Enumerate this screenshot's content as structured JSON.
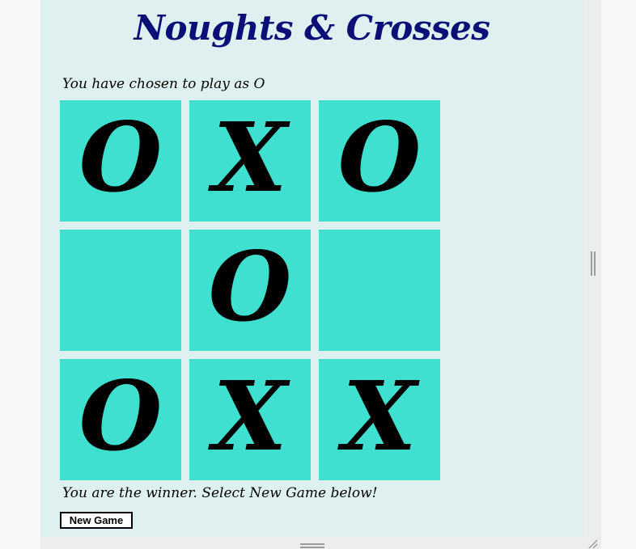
{
  "app": {
    "title": "Noughts & Crosses"
  },
  "status": {
    "chosen": "You have chosen to play as O",
    "result": "You are the winner. Select New Game below!"
  },
  "board": {
    "cells": [
      "O",
      "X",
      "O",
      "",
      "O",
      "",
      "O",
      "X",
      "X"
    ]
  },
  "controls": {
    "new_game_label": "New Game"
  },
  "colors": {
    "title": "#0d0f78",
    "panel_background": "#def0ef",
    "cell_background": "#40e0d0",
    "mark": "#000000"
  },
  "icons": {
    "vertical_resize": "double-bar-vertical-icon",
    "horizontal_resize": "double-bar-horizontal-icon",
    "corner_resize": "resize-corner-icon"
  }
}
